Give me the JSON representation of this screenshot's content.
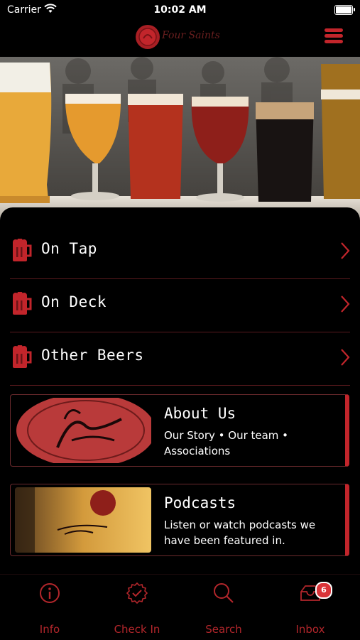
{
  "status_bar": {
    "carrier": "Carrier",
    "time": "10:02 AM"
  },
  "header": {
    "logo_text": "Four Saints",
    "menu_icon": "hamburger-icon"
  },
  "colors": {
    "accent": "#c2252b",
    "background": "#000000",
    "divider": "#5a1a1d"
  },
  "list": {
    "items": [
      {
        "label": "On Tap",
        "icon": "beer-mug-icon"
      },
      {
        "label": "On Deck",
        "icon": "beer-mug-icon"
      },
      {
        "label": "Other Beers",
        "icon": "beer-mug-icon"
      }
    ]
  },
  "cards": [
    {
      "title": "About Us",
      "description": "Our Story • Our team • Associations"
    },
    {
      "title": "Podcasts",
      "description": "Listen or watch podcasts we have been featured in."
    }
  ],
  "tabbar": {
    "tabs": [
      {
        "label": "Info",
        "icon": "info-icon"
      },
      {
        "label": "Check In",
        "icon": "check-badge-icon"
      },
      {
        "label": "Search",
        "icon": "search-icon"
      },
      {
        "label": "Inbox",
        "icon": "inbox-icon",
        "badge": "6"
      }
    ]
  }
}
